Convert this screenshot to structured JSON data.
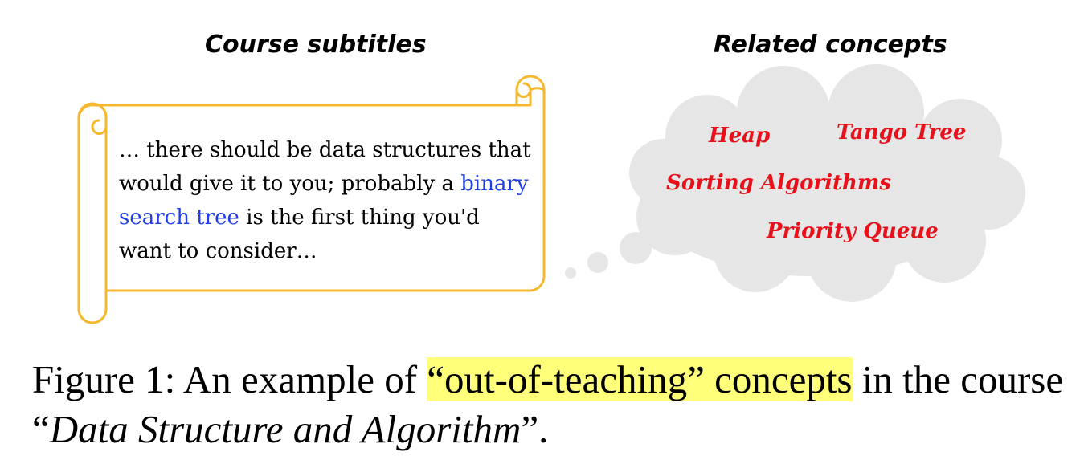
{
  "headings": {
    "left": "Course subtitles",
    "right": "Related concepts"
  },
  "subtitle": {
    "before": "… there should be data structures that would give it to you; probably a ",
    "term": "binary search tree",
    "after": " is the first thing you'd want to consider…"
  },
  "concepts": {
    "heap": "Heap",
    "tango": "Tango Tree",
    "sorting": "Sorting Algorithms",
    "priority": "Priority Queue"
  },
  "caption": {
    "prefix": "Figure 1: An example of ",
    "highlighted": "“out-of-teaching” concepts",
    "middle": " in the course “",
    "course": "Data Structure and Algorithm",
    "suffix": "”."
  },
  "colors": {
    "scroll_outline": "#f5b82e",
    "cloud_fill": "#e6e6e6",
    "concept_text": "#e8101a",
    "term_text": "#1f3ee8",
    "caption_highlight": "#ffff7a"
  }
}
